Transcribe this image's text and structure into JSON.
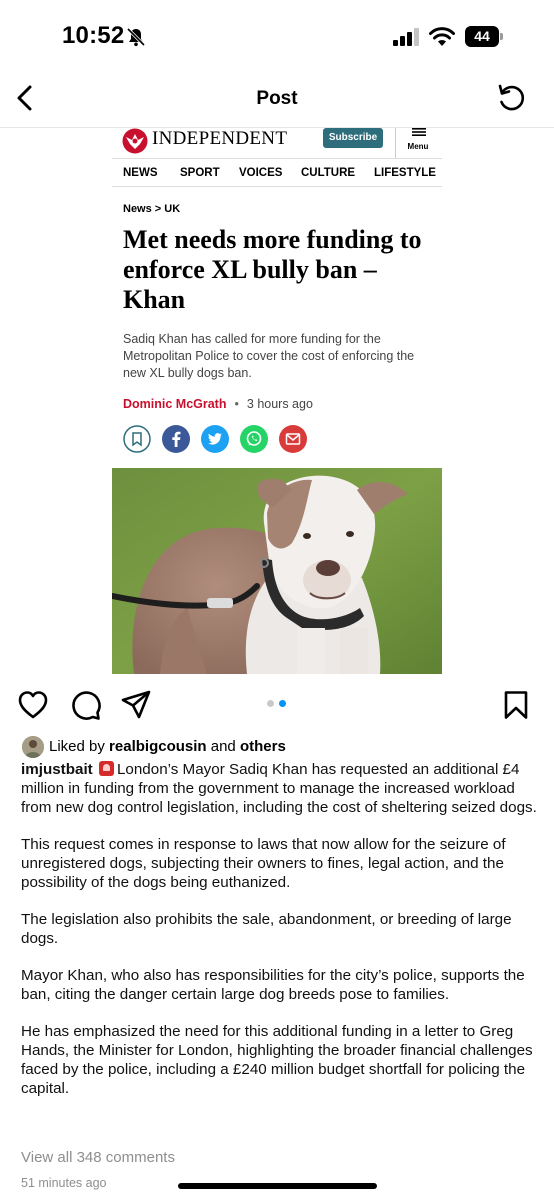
{
  "status_bar": {
    "time": "10:52",
    "battery_level": "44",
    "icons": [
      "bell-slash-icon",
      "signal-icon",
      "wifi-icon",
      "battery-icon"
    ]
  },
  "nav": {
    "title": "Post",
    "back_icon": "chevron-left-icon",
    "refresh_icon": "refresh-icon"
  },
  "article": {
    "brand": "INDEPENDENT",
    "subscribe_label": "Subscribe",
    "menu_label": "Menu",
    "sections": [
      "NEWS",
      "SPORT",
      "VOICES",
      "CULTURE",
      "LIFESTYLE"
    ],
    "breadcrumb": "News > UK",
    "headline": "Met needs more funding to enforce XL bully ban – Khan",
    "standfirst": "Sadiq Khan has called for more funding for the Metropolitan Police to cover the cost of enforcing the new XL bully dogs ban.",
    "author": "Dominic McGrath",
    "byline_separator": "•",
    "published": "3 hours ago",
    "share_icons": [
      "bookmark-icon",
      "facebook-icon",
      "twitter-icon",
      "whatsapp-icon",
      "email-icon"
    ],
    "photo": "xl-bully-dog-photo"
  },
  "actions": {
    "icons": [
      "heart-icon",
      "comment-icon",
      "share-icon",
      "save-icon"
    ],
    "carousel": {
      "count": 2,
      "active": 2
    }
  },
  "likes": {
    "prefix": "Liked by ",
    "user": "realbigcousin",
    "middle": " and ",
    "others": "others"
  },
  "caption": {
    "username": "imjustbait",
    "paragraphs": [
      "London’s Mayor Sadiq Khan has requested an additional £4 million in funding from the government to manage the increased workload from new dog control legislation, including the cost of sheltering seized dogs.",
      "This request comes in response to laws that now allow for the seizure of unregistered dogs, subjecting their owners to fines, legal action, and the possibility of the dogs being euthanized.",
      "The legislation also prohibits the sale, abandonment, or breeding of large dogs.",
      "Mayor Khan, who also has responsibilities for the city’s police, supports the ban, citing the danger certain large dog breeds pose to families.",
      "He has emphasized the need for this additional funding in a letter to Greg Hands, the Minister for London, highlighting the broader financial challenges faced by the police, including a £240 million budget shortfall for policing the capital."
    ]
  },
  "comments": {
    "view_all": "View all 348 comments"
  },
  "post_time": "51 minutes ago",
  "colors": {
    "independent_red": "#c8102e",
    "subscribe_teal": "#2e6d7c",
    "facebook": "#3b5998",
    "twitter": "#1da1f2",
    "whatsapp": "#25d366",
    "email": "#d93a3a",
    "carousel_active": "#0095f6",
    "muted_text": "#8e8e8e"
  }
}
